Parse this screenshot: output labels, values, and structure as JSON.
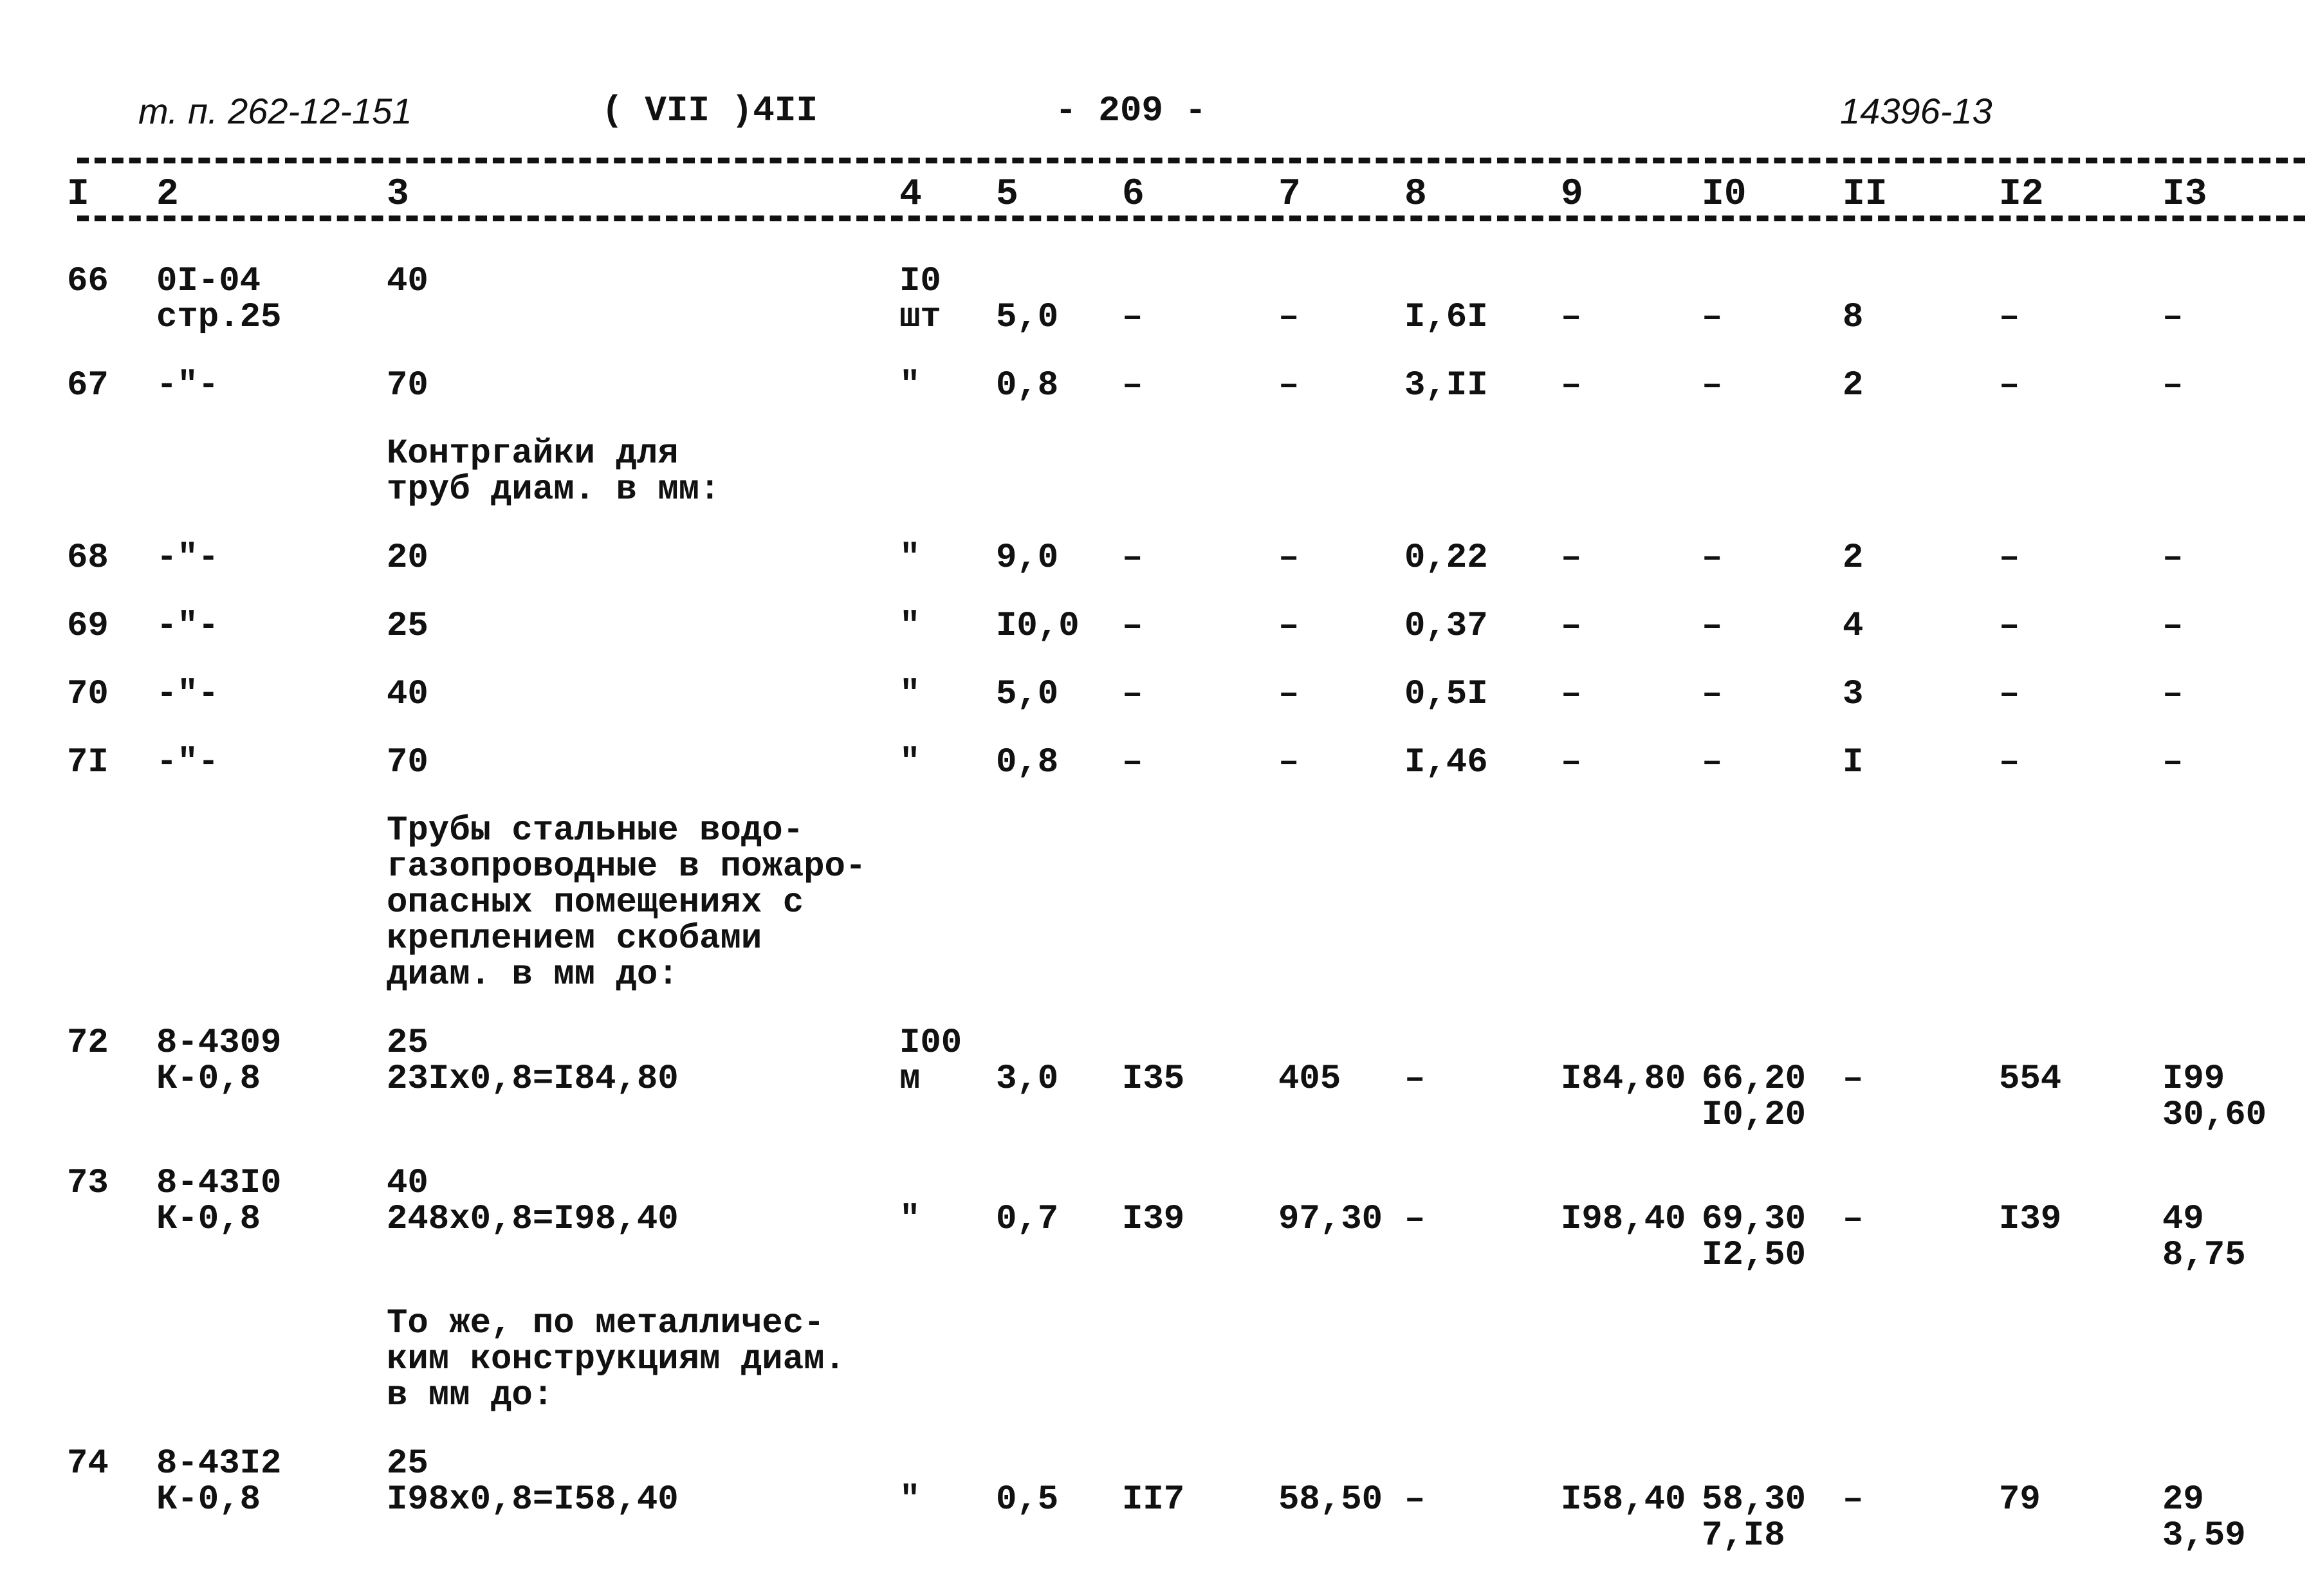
{
  "header": {
    "doc_code": "т. п. 262-12-151",
    "album": "( VII )4II",
    "page": "- 209 -",
    "sheet_code": "14396-13"
  },
  "column_numbers": [
    "I",
    "2",
    "3",
    "4",
    "5",
    "6",
    "7",
    "8",
    "9",
    "I0",
    "II",
    "I2",
    "I3"
  ],
  "rows": [
    {
      "type": "data",
      "cells": [
        "66",
        "0I-04\nстр.25",
        "40",
        "I0\nшт",
        "\n5,0",
        "\n–",
        "\n–",
        "\nI,6I",
        "\n–",
        "\n–",
        "\n8",
        "\n–",
        "\n–"
      ]
    },
    {
      "type": "data",
      "cells": [
        "67",
        "-\"-",
        "70",
        "\"",
        "0,8",
        "–",
        "–",
        "3,II",
        "–",
        "–",
        "2",
        "–",
        "–"
      ]
    },
    {
      "type": "note",
      "text": "Контргайки для\nтруб диам. в мм:"
    },
    {
      "type": "data",
      "cells": [
        "68",
        "-\"-",
        "20",
        "\"",
        "9,0",
        "–",
        "–",
        "0,22",
        "–",
        "–",
        "2",
        "–",
        "–"
      ]
    },
    {
      "type": "data",
      "cells": [
        "69",
        "-\"-",
        "25",
        "\"",
        "I0,0",
        "–",
        "–",
        "0,37",
        "–",
        "–",
        "4",
        "–",
        "–"
      ]
    },
    {
      "type": "data",
      "cells": [
        "70",
        "-\"-",
        "40",
        "\"",
        "5,0",
        "–",
        "–",
        "0,5I",
        "–",
        "–",
        "3",
        "–",
        "–"
      ]
    },
    {
      "type": "data",
      "cells": [
        "7I",
        "-\"-",
        "70",
        "\"",
        "0,8",
        "–",
        "–",
        "I,46",
        "–",
        "–",
        "I",
        "–",
        "–"
      ]
    },
    {
      "type": "note",
      "text": "Трубы стальные водо-\nгазопроводные в пожаро-\nопасных помещениях с\nкреплением скобами\nдиам. в мм до:"
    },
    {
      "type": "data",
      "cells": [
        "72",
        "8-4309\nК-0,8",
        "25\n23Ix0,8=I84,80",
        "I00\nм",
        "\n3,0",
        "\nI35",
        "\n405",
        "\n–",
        "\nI84,80",
        "\n66,20\nI0,20",
        "\n–",
        "\n554",
        "\nI99\n30,60"
      ]
    },
    {
      "type": "data",
      "cells": [
        "73",
        "8-43I0\nК-0,8",
        "40\n248x0,8=I98,40",
        "\n\"",
        "\n0,7",
        "\nI39",
        "\n97,30",
        "\n–",
        "\nI98,40",
        "\n69,30\nI2,50",
        "\n–",
        "\nI39",
        "\n49\n8,75"
      ]
    },
    {
      "type": "note",
      "text": "То же, по металличес-\nким конструкциям диам.\nв мм до:"
    },
    {
      "type": "data",
      "cells": [
        "74",
        "8-43I2\nК-0,8",
        "25\nI98x0,8=I58,40",
        "\n\"",
        "\n0,5",
        "\nII7",
        "\n58,50",
        "\n–",
        "\nI58,40",
        "\n58,30\n7,I8",
        "\n–",
        "\n79",
        "\n29\n3,59"
      ]
    }
  ]
}
